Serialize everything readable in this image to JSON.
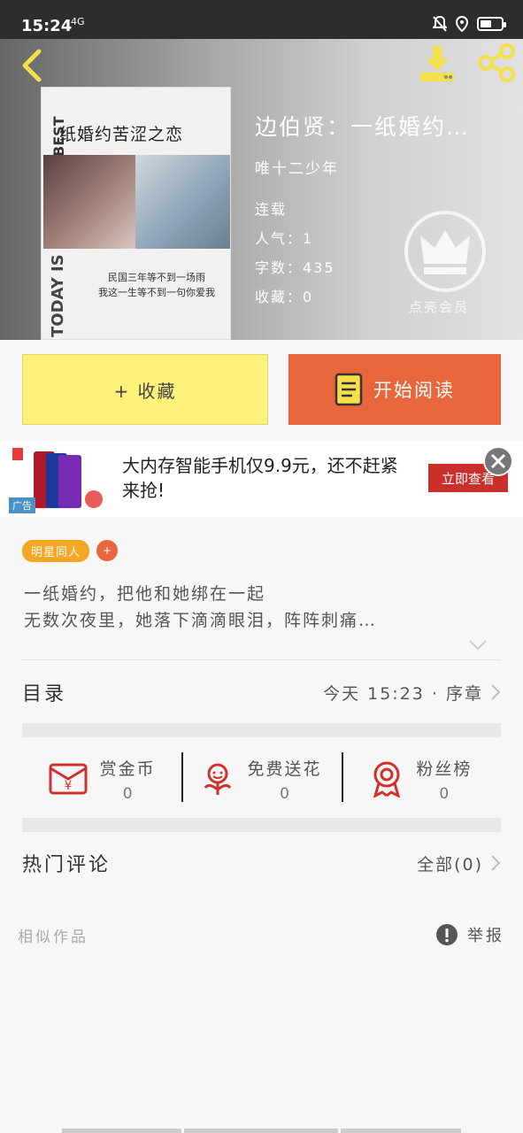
{
  "status_bar": {
    "time": "15:24",
    "network": "4G"
  },
  "book": {
    "title": "边伯贤：一纸婚约…",
    "author": "唯十二少年",
    "status": "连载",
    "popularity": "人气：1",
    "word_count": "字数：435",
    "favorites": "收藏：0",
    "cover": {
      "title": "纸婚约苦涩之恋",
      "side_text_top": "BEST",
      "side_text_bottom": "TODAY IS",
      "poem": "民国三年等不到一场雨\n我这一生等不到一句你爱我"
    }
  },
  "vip_label": "点亮会员",
  "buttons": {
    "favorite": "+ 收藏",
    "read": "开始阅读"
  },
  "ad": {
    "text": "大内存智能手机仅9.9元，还不赶紧来抢!",
    "cta": "立即查看",
    "tag": "广告"
  },
  "tags": {
    "main": "明星同人",
    "add": "+"
  },
  "intro": "一纸婚约，把他和她绑在一起\n无数次夜里，她落下滴滴眼泪，阵阵刺痛…",
  "toc": {
    "label": "目录",
    "latest": "今天 15:23 · 序章"
  },
  "stats": [
    {
      "name": "赏金币",
      "value": "0"
    },
    {
      "name": "免费送花",
      "value": "0"
    },
    {
      "name": "粉丝榜",
      "value": "0"
    }
  ],
  "comments": {
    "label": "热门评论",
    "all": "全部(0)"
  },
  "similar": "相似作品",
  "report": "举报",
  "colors": {
    "accent_orange": "#e8663b",
    "fav_yellow": "#fef27b",
    "icon_yellow": "#f4e04a",
    "stat_red": "#d0312d"
  }
}
